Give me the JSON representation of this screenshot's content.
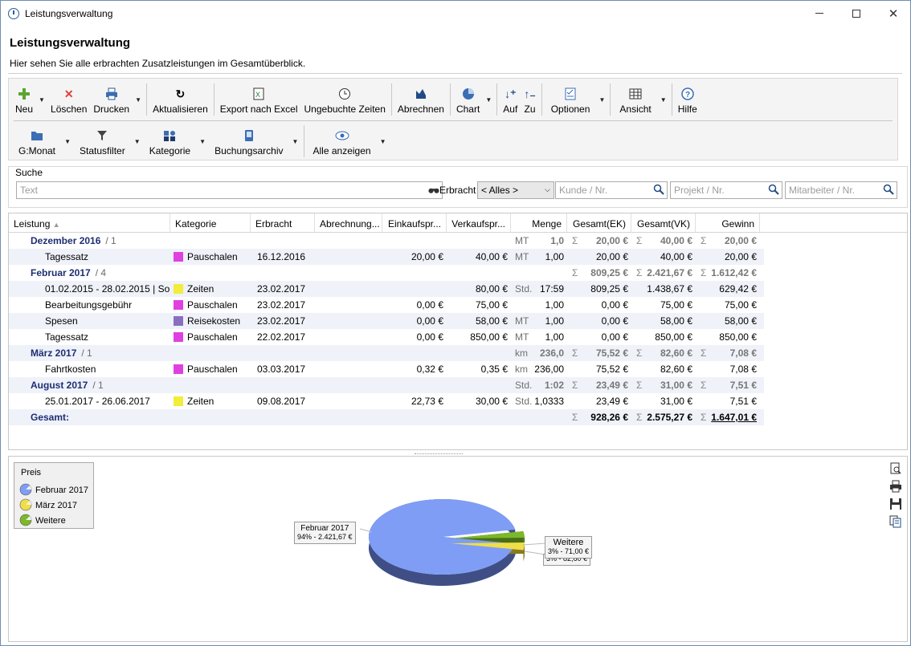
{
  "window": {
    "title": "Leistungsverwaltung"
  },
  "header": {
    "title": "Leistungsverwaltung",
    "subtitle": "Hier sehen Sie alle erbrachten Zusatzleistungen im Gesamtüberblick."
  },
  "toolbar": {
    "row1": [
      "Neu",
      "Löschen",
      "Drucken",
      "Aktualisieren",
      "Export nach Excel",
      "Ungebuchte Zeiten",
      "Abrechnen",
      "Chart",
      "Auf",
      "Zu",
      "Optionen",
      "Ansicht",
      "Hilfe"
    ],
    "row2": [
      "G:Monat",
      "Statusfilter",
      "Kategorie",
      "Buchungsarchiv",
      "Alle anzeigen"
    ]
  },
  "search": {
    "label": "Suche",
    "text_placeholder": "Text",
    "erbracht_label": "Erbracht",
    "erbracht_value": "< Alles >",
    "kunde_placeholder": "Kunde / Nr.",
    "projekt_placeholder": "Projekt / Nr.",
    "mitarbeiter_placeholder": "Mitarbeiter / Nr."
  },
  "grid": {
    "columns": [
      "Leistung",
      "Kategorie",
      "Erbracht",
      "Abrechnung...",
      "Einkaufspr...",
      "Verkaufspr...",
      "Menge",
      "Gesamt(EK)",
      "Gesamt(VK)",
      "Gewinn"
    ],
    "sort_column": "Leistung",
    "sigma": "Σ",
    "groups": [
      {
        "name": "Dezember 2016",
        "count": "/ 1",
        "unit": "MT",
        "menge": "1,0",
        "ek": "20,00 €",
        "vk": "40,00 €",
        "gewinn": "20,00 €",
        "rows": [
          {
            "leistung": "Tagessatz",
            "kategorie": "Pauschalen",
            "color": "#e040e0",
            "erbracht": "16.12.2016",
            "ekp": "20,00 €",
            "vkp": "40,00 €",
            "unit": "MT",
            "menge": "1,00",
            "ek": "20,00 €",
            "vk": "40,00 €",
            "gewinn": "20,00 €"
          }
        ]
      },
      {
        "name": "Februar 2017",
        "count": "/ 4",
        "unit": "",
        "menge": "",
        "ek": "809,25 €",
        "vk": "2.421,67 €",
        "gewinn": "1.612,42 €",
        "rows": [
          {
            "leistung": "01.02.2015 - 28.02.2015 | So...",
            "kategorie": "Zeiten",
            "color": "#f2ec3a",
            "erbracht": "23.02.2017",
            "ekp": "",
            "vkp": "80,00 €",
            "unit": "Std.",
            "menge": "17:59",
            "ek": "809,25 €",
            "vk": "1.438,67 €",
            "gewinn": "629,42 €"
          },
          {
            "leistung": "Bearbeitungsgebühr",
            "kategorie": "Pauschalen",
            "color": "#e040e0",
            "erbracht": "23.02.2017",
            "ekp": "0,00 €",
            "vkp": "75,00 €",
            "unit": "",
            "menge": "1,00",
            "ek": "0,00 €",
            "vk": "75,00 €",
            "gewinn": "75,00 €"
          },
          {
            "leistung": "Spesen",
            "kategorie": "Reisekosten",
            "color": "#8a6fc0",
            "erbracht": "23.02.2017",
            "ekp": "0,00 €",
            "vkp": "58,00 €",
            "unit": "MT",
            "menge": "1,00",
            "ek": "0,00 €",
            "vk": "58,00 €",
            "gewinn": "58,00 €"
          },
          {
            "leistung": "Tagessatz",
            "kategorie": "Pauschalen",
            "color": "#e040e0",
            "erbracht": "22.02.2017",
            "ekp": "0,00 €",
            "vkp": "850,00 €",
            "unit": "MT",
            "menge": "1,00",
            "ek": "0,00 €",
            "vk": "850,00 €",
            "gewinn": "850,00 €"
          }
        ]
      },
      {
        "name": "März 2017",
        "count": "/ 1",
        "unit": "km",
        "menge": "236,0",
        "ek": "75,52 €",
        "vk": "82,60 €",
        "gewinn": "7,08 €",
        "rows": [
          {
            "leistung": "Fahrtkosten",
            "kategorie": "Pauschalen",
            "color": "#e040e0",
            "erbracht": "03.03.2017",
            "ekp": "0,32 €",
            "vkp": "0,35 €",
            "unit": "km",
            "menge": "236,00",
            "ek": "75,52 €",
            "vk": "82,60 €",
            "gewinn": "7,08 €"
          }
        ]
      },
      {
        "name": "August 2017",
        "count": "/ 1",
        "unit": "Std.",
        "menge": "1:02",
        "ek": "23,49 €",
        "vk": "31,00 €",
        "gewinn": "7,51 €",
        "rows": [
          {
            "leistung": "25.01.2017 - 26.06.2017",
            "kategorie": "Zeiten",
            "color": "#f2ec3a",
            "erbracht": "09.08.2017",
            "ekp": "22,73 €",
            "vkp": "30,00 €",
            "unit": "Std.",
            "menge": "1,0333",
            "ek": "23,49 €",
            "vk": "31,00 €",
            "gewinn": "7,51 €"
          }
        ]
      }
    ],
    "total": {
      "label": "Gesamt:",
      "ek": "928,26 €",
      "vk": "2.575,27 €",
      "gewinn": "1.647,01 €"
    }
  },
  "chart_data": {
    "type": "pie",
    "legend_title": "Preis",
    "legend_placement": "top-left",
    "categories": [
      "Februar 2017",
      "März 2017",
      "Weitere"
    ],
    "values": [
      2421.67,
      82.6,
      71.0
    ],
    "percent_labels": [
      "94%",
      "3%",
      "3%"
    ],
    "value_labels": [
      "2.421,67 €",
      "82,60 €",
      "71,00 €"
    ],
    "colors": [
      "#7f9df5",
      "#f0de48",
      "#7cb82a"
    ],
    "callouts": [
      {
        "name": "Februar 2017",
        "text": "94% - 2.421,67 €"
      },
      {
        "name": "Weitere",
        "text": "3% - 71,00 €"
      },
      {
        "name": "",
        "text": "3% - 82,60 €"
      }
    ]
  }
}
